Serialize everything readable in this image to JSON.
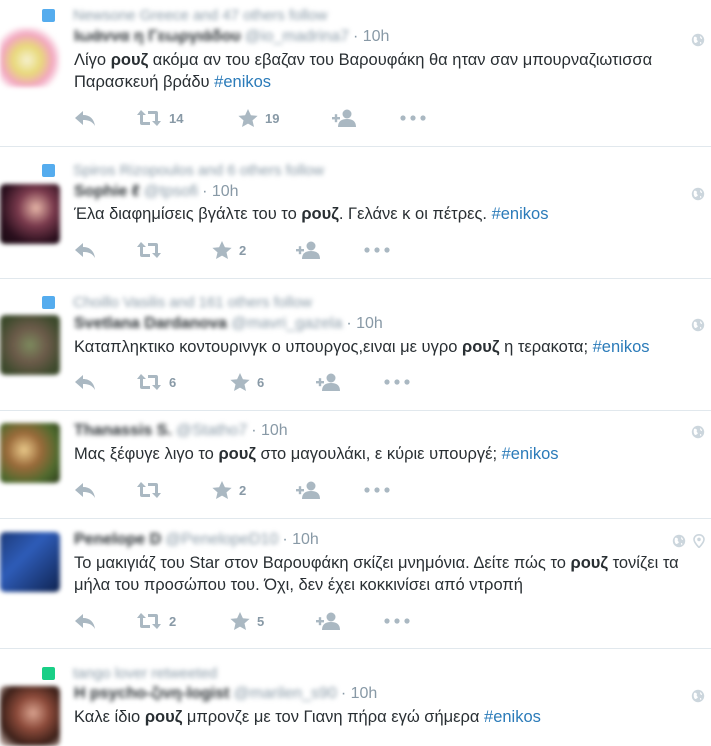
{
  "colors": {
    "hashtag": "#2b7bb9",
    "meta": "#8899a6",
    "text": "#292f33",
    "follow_ctx": "#55acee",
    "retweet_ctx": "#19cf86"
  },
  "tweets": [
    {
      "context": "Newsone Greece and 47 others follow",
      "context_icon": "follow-icon",
      "name": "Ιωάννα η Γεωργιάδου",
      "handle": "@io_madrina7",
      "time": "· 10h",
      "pre": "Λίγο ",
      "bold": "ρουζ",
      "post": " ακόμα αν του εβαζαν του Βαρουφάκη θα ηταν σαν μπουρναζιωτισσα Παρασκευή βράδυ ",
      "hashtag": "#enikos",
      "retweets": "14",
      "likes": "19"
    },
    {
      "context": "Spiros Rizopoulos and 6 others follow",
      "context_icon": "follow-icon",
      "name": "Sophie ℓ",
      "handle": "@tpsofi",
      "time": "· 10h",
      "pre": "Έλα διαφημίσεις βγάλτε του το ",
      "bold": "ρουζ",
      "post": ". Γελάνε κ οι πέτρες. ",
      "hashtag": "#enikos",
      "retweets": "",
      "likes": "2"
    },
    {
      "context": "Choillo Vasilis and 161 others follow",
      "context_icon": "follow-icon",
      "name": "Svetlana Dardanova",
      "handle": "@mavri_gazela",
      "time": "· 10h",
      "pre": "Καταπληκτικο κοντουρινγκ ο υπουργος,ειναι με υγρο ",
      "bold": "ρουζ",
      "post": " η τερακοτα; ",
      "hashtag": "#enikos",
      "retweets": "6",
      "likes": "6"
    },
    {
      "context": "",
      "context_icon": "",
      "name": "Thanassis S.",
      "handle": "@Statho7",
      "time": "· 10h",
      "pre": "Μας ξέφυγε λιγο το ",
      "bold": "ρουζ",
      "post": " στο μαγουλάκι, ε κύριε υπουργέ; ",
      "hashtag": "#enikos",
      "retweets": "",
      "likes": "2"
    },
    {
      "context": "",
      "context_icon": "",
      "name": "Penelope D",
      "handle": "@PenelopeD10",
      "time": "· 10h",
      "pre": "Το μακιγιάζ του Star στον Βαρουφάκη σκίζει μνημόνια. Δείτε πώς το ",
      "bold": "ρουζ",
      "post": " τονίζει τα μήλα του προσώπου του. Όχι, δεν έχει κοκκινίσει από ντροπή",
      "hashtag": "",
      "retweets": "2",
      "likes": "5"
    },
    {
      "context": "tango lover retweeted",
      "context_icon": "retweet-context-icon",
      "name": "Η psycho-ζινη-logist",
      "handle": "@marilen_s90",
      "time": "· 10h",
      "pre": "Καλε ίδιο ",
      "bold": "ρουζ",
      "post": " μπρονζε με τον Γιανη πήρα εγώ σήμερα ",
      "hashtag": "#enikos",
      "retweets": "",
      "likes": ""
    }
  ]
}
